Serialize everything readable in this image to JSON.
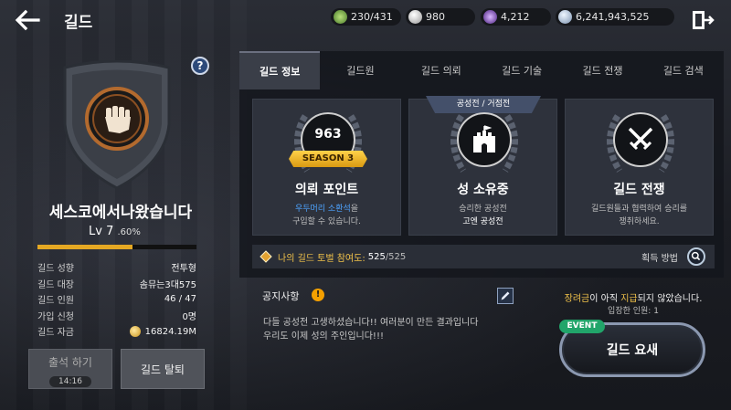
{
  "header": {
    "title": "길드",
    "resources": [
      {
        "icon": "stamina-icon",
        "value": "230/431"
      },
      {
        "icon": "pearl-icon",
        "value": "980"
      },
      {
        "icon": "crystal-icon",
        "value": "4,212"
      },
      {
        "icon": "silver-coin-icon",
        "value": "6,241,943,525"
      }
    ]
  },
  "guild": {
    "name": "세스코에서나왔습니다",
    "level": "Lv 7",
    "level_pct": ".60%",
    "xp_fraction": 0.6,
    "info": [
      {
        "key": "길드 성향",
        "value": "전투형"
      },
      {
        "key": "길드 대장",
        "value": "솜뮤는3대575"
      },
      {
        "key": "길드 인원",
        "value": "46 / 47"
      },
      {
        "key": "가입 신청",
        "value": "0명"
      },
      {
        "key": "길드 자금",
        "value": "16824.19M"
      }
    ],
    "attend_label": "출석 하기",
    "attend_time": "14:16",
    "leave_label": "길드 탈퇴"
  },
  "tabs": [
    "길드 정보",
    "길드원",
    "길드 의뢰",
    "길드 기술",
    "길드 전쟁",
    "길드 검색"
  ],
  "cards": {
    "request": {
      "points": "963",
      "season": "SEASON 3",
      "title": "의뢰 포인트",
      "desc_highlight": "우두머리 소환석",
      "desc_1": "을",
      "desc_2": "구입할 수 있습니다."
    },
    "siege": {
      "tag": "공성전 / 거점전",
      "title": "성 소유중",
      "desc_1": "승리한 공성전",
      "desc_2": "고엔 공성전"
    },
    "war": {
      "title": "길드 전쟁",
      "desc_1": "길드원들과 협력하여 승리를",
      "desc_2": "쟁취하세요."
    }
  },
  "tournament": {
    "label": "나의 길드 토벌 참여도:",
    "value": "525",
    "max": "/525",
    "how": "획득 방법"
  },
  "notice": {
    "title": "공지사항",
    "line1": "다들 공성전 고생하셨습니다!! 여러분이 만든 결과입니다",
    "line2": "우리도 이제 성의 주인입니다!!!"
  },
  "fortress": {
    "msg_y": "장려금",
    "msg_a": "이 아직 ",
    "msg_y2": "지급",
    "msg_b": "되지 않았습니다.",
    "entered": "입장한 인원: 1",
    "event": "EVENT",
    "button": "길드 요새"
  }
}
